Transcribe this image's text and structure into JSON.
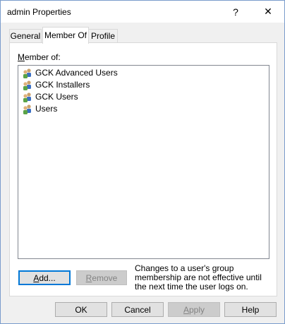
{
  "window": {
    "title": "admin Properties",
    "help_glyph": "?",
    "close_glyph": "✕"
  },
  "tabs": [
    {
      "label": "General",
      "active": false
    },
    {
      "label": "Member Of",
      "active": true
    },
    {
      "label": "Profile",
      "active": false
    }
  ],
  "member_of": {
    "label_accel": "M",
    "label_rest": "ember of:",
    "groups": [
      {
        "name": "GCK Advanced Users",
        "icon": "group-icon"
      },
      {
        "name": "GCK Installers",
        "icon": "group-icon"
      },
      {
        "name": "GCK Users",
        "icon": "group-icon"
      },
      {
        "name": "Users",
        "icon": "group-icon"
      }
    ]
  },
  "actions": {
    "add_accel": "A",
    "add_rest": "dd...",
    "remove_accel": "R",
    "remove_rest": "emove",
    "note": "Changes to a user's group membership are not effective until the next time the user logs on."
  },
  "footer": {
    "ok": "OK",
    "cancel": "Cancel",
    "apply_accel": "A",
    "apply_rest": "pply",
    "help": "Help"
  },
  "colors": {
    "accent": "#0078d7",
    "border": "#adadad",
    "face": "#f0f0f0"
  }
}
